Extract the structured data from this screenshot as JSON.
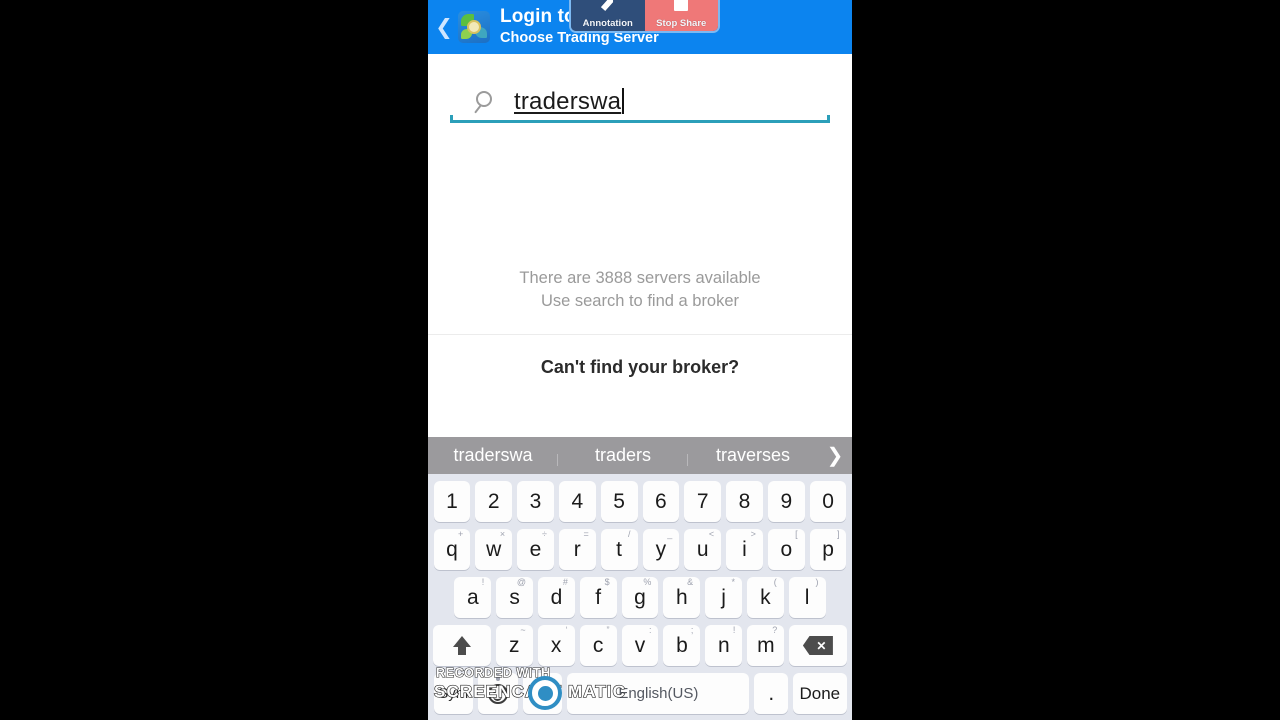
{
  "header": {
    "back_icon": "chevron-left-icon",
    "app_icon": "metatrader-app-icon",
    "title": "Login to an account",
    "subtitle": "Choose Trading Server"
  },
  "share_overlay": {
    "annotate_label": "Annotation",
    "annotate_icon": "pencil-icon",
    "stop_label": "Stop Share",
    "stop_icon": "stop-square-icon",
    "annotate_color": "#2f4e7a",
    "stop_color": "#ef7878"
  },
  "search": {
    "icon": "search-icon",
    "value": "traderswa",
    "underline_color": "#2b9fb9"
  },
  "empty_state": {
    "line1": "There are 3888 servers available",
    "line2": "Use search to find a broker",
    "server_count": 3888
  },
  "broker_cta": {
    "label": "Can't find your broker?"
  },
  "keyboard": {
    "suggestions": [
      "traderswa",
      "traders",
      "traverses"
    ],
    "suggestion_arrow_icon": "chevron-right-icon",
    "rows": {
      "numbers": [
        {
          "main": "1",
          "sup": ""
        },
        {
          "main": "2",
          "sup": ""
        },
        {
          "main": "3",
          "sup": ""
        },
        {
          "main": "4",
          "sup": ""
        },
        {
          "main": "5",
          "sup": ""
        },
        {
          "main": "6",
          "sup": ""
        },
        {
          "main": "7",
          "sup": ""
        },
        {
          "main": "8",
          "sup": ""
        },
        {
          "main": "9",
          "sup": ""
        },
        {
          "main": "0",
          "sup": ""
        }
      ],
      "qwerty": [
        {
          "main": "q",
          "sup": "+"
        },
        {
          "main": "w",
          "sup": "×"
        },
        {
          "main": "e",
          "sup": "÷"
        },
        {
          "main": "r",
          "sup": "="
        },
        {
          "main": "t",
          "sup": "/"
        },
        {
          "main": "y",
          "sup": "_"
        },
        {
          "main": "u",
          "sup": "<"
        },
        {
          "main": "i",
          "sup": ">"
        },
        {
          "main": "o",
          "sup": "["
        },
        {
          "main": "p",
          "sup": "]"
        }
      ],
      "asdf": [
        {
          "main": "a",
          "sup": "!"
        },
        {
          "main": "s",
          "sup": "@"
        },
        {
          "main": "d",
          "sup": "#"
        },
        {
          "main": "f",
          "sup": "$"
        },
        {
          "main": "g",
          "sup": "%"
        },
        {
          "main": "h",
          "sup": "&"
        },
        {
          "main": "j",
          "sup": "*"
        },
        {
          "main": "k",
          "sup": "("
        },
        {
          "main": "l",
          "sup": ")"
        }
      ],
      "zxcv": [
        {
          "main": "z",
          "sup": "~"
        },
        {
          "main": "x",
          "sup": "‘"
        },
        {
          "main": "c",
          "sup": "”"
        },
        {
          "main": "v",
          "sup": ":"
        },
        {
          "main": "b",
          "sup": ";"
        },
        {
          "main": "n",
          "sup": "!"
        },
        {
          "main": "m",
          "sup": "?"
        }
      ]
    },
    "shift_icon": "shift-up-arrow-icon",
    "backspace_icon": "backspace-icon",
    "sym_label": "Sym",
    "emoji_icon": "emoji-smiley-icon",
    "mic_icon": "microphone-icon",
    "question_label": "?",
    "space_label": "English(US)",
    "period_label": ".",
    "done_label": "Done"
  },
  "watermark": {
    "line1": "RECORDED WITH",
    "line2": "SCREENCAST       MATIC",
    "logo_icon": "screencast-o-matic-logo-icon"
  }
}
